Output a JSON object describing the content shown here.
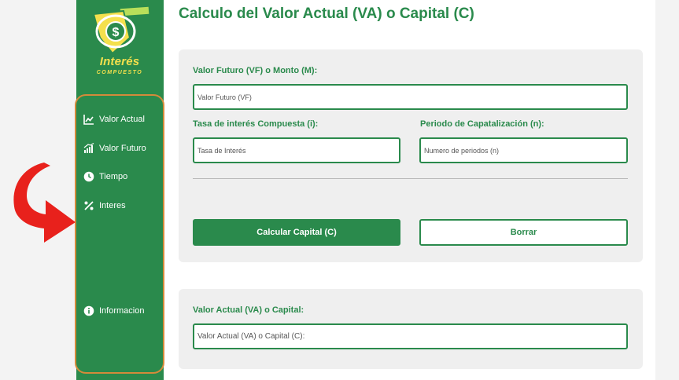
{
  "brand": {
    "logo_title": "Interés",
    "logo_subtitle": "COMPUESTO"
  },
  "sidebar": {
    "items": [
      {
        "label": "Valor Actual",
        "icon": "line-chart-icon"
      },
      {
        "label": "Valor Futuro",
        "icon": "growth-chart-icon"
      },
      {
        "label": "Tiempo",
        "icon": "clock-icon"
      },
      {
        "label": "Interes",
        "icon": "percent-icon"
      },
      {
        "label": "Informacion",
        "icon": "info-icon"
      }
    ]
  },
  "main": {
    "title": "Calculo del Valor Actual (VA) o Capital (C)",
    "form": {
      "future_value": {
        "label": "Valor Futuro (VF) o Monto (M):",
        "placeholder": "Valor Futuro (VF)",
        "value": ""
      },
      "interest_rate": {
        "label": "Tasa de interés Compuesta (i):",
        "placeholder": "Tasa de Interés",
        "value": ""
      },
      "periods": {
        "label": "Periodo de Capatalización (n):",
        "placeholder": "Numero de periodos (n)",
        "value": ""
      },
      "calculate_label": "Calcular Capital (C)",
      "clear_label": "Borrar"
    },
    "result": {
      "label": "Valor Actual (VA) o Capital:",
      "placeholder": "Valor Actual (VA) o Capital (C):",
      "value": ""
    }
  },
  "colors": {
    "primary": "#2a8a4c",
    "accent": "#f4e04d",
    "highlight_border": "#d48a3a",
    "arrow": "#e8211c"
  }
}
